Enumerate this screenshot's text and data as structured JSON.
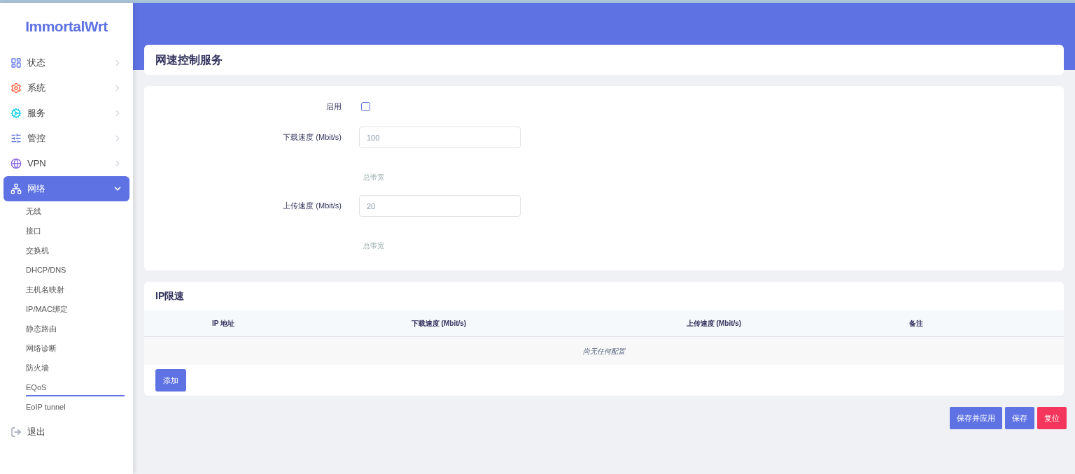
{
  "brand": "ImmortalWrt",
  "nav": [
    {
      "kind": "status",
      "label": "状态",
      "expanded": false
    },
    {
      "kind": "system",
      "label": "系统",
      "expanded": false
    },
    {
      "kind": "services",
      "label": "服务",
      "expanded": false
    },
    {
      "kind": "control",
      "label": "管控",
      "expanded": false
    },
    {
      "kind": "vpn",
      "label": "VPN",
      "expanded": false
    },
    {
      "kind": "network",
      "label": "网络",
      "expanded": true,
      "children": [
        {
          "label": "无线",
          "selected": false
        },
        {
          "label": "接口",
          "selected": false
        },
        {
          "label": "交换机",
          "selected": false
        },
        {
          "label": "DHCP/DNS",
          "selected": false
        },
        {
          "label": "主机名映射",
          "selected": false
        },
        {
          "label": "IP/MAC绑定",
          "selected": false
        },
        {
          "label": "静态路由",
          "selected": false
        },
        {
          "label": "网络诊断",
          "selected": false
        },
        {
          "label": "防火墙",
          "selected": false
        },
        {
          "label": "EQoS",
          "selected": true
        },
        {
          "label": "EoIP tunnel",
          "selected": false
        }
      ]
    },
    {
      "kind": "logout",
      "label": "退出",
      "expanded": false
    }
  ],
  "page_title": "网速控制服务",
  "form": [
    {
      "kind": "checkbox",
      "label": "启用",
      "checked": false
    },
    {
      "kind": "text",
      "label": "下载速度 (Mbit/s)",
      "placeholder": "100",
      "hint": "总带宽"
    },
    {
      "kind": "text",
      "label": "上传速度 (Mbit/s)",
      "placeholder": "20",
      "hint": "总带宽"
    }
  ],
  "ip_table": {
    "title": "IP限速",
    "columns": [
      "IP 地址",
      "下载速度 (Mbit/s)",
      "上传速度 (Mbit/s)",
      "备注"
    ],
    "empty_text": "尚无任何配置",
    "add_button": "添加"
  },
  "actions": [
    {
      "kind": "primary",
      "label": "保存并应用"
    },
    {
      "kind": "primary",
      "label": "保存"
    },
    {
      "kind": "danger",
      "label": "复位"
    }
  ]
}
